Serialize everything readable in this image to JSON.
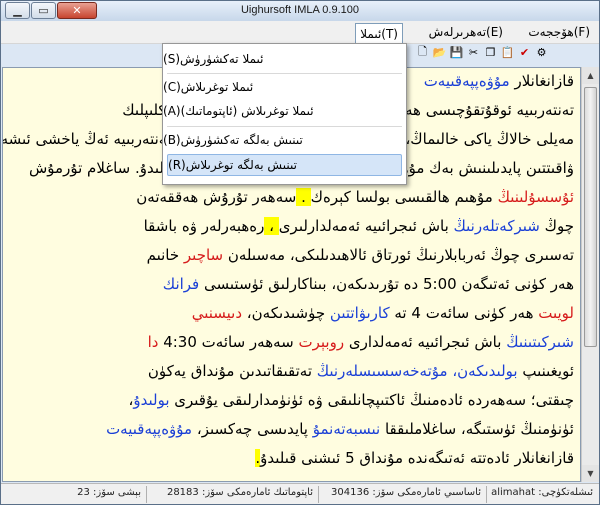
{
  "window": {
    "title": "Uighursoft IMLA 0.9.100"
  },
  "menubar": {
    "items": [
      {
        "label": "ھۆججەت(F)"
      },
      {
        "label": "تەھرىرلەش(E)"
      },
      {
        "label": "ئىملا(T)"
      }
    ]
  },
  "dropdown": {
    "items": [
      {
        "label": "ئىملا تەكشۈرۈش(S)"
      },
      {
        "label": "ئىملا توغرىلاش(C)"
      },
      {
        "label": "ئىملا توغرىلاش (ئاپتوماتىك)(A)"
      },
      {
        "label": "تىنىش بەلگە تەكشۈرۈش(B)"
      },
      {
        "label": "تىنىش بەلگە توغرىلاش(R)"
      }
    ]
  },
  "editor": {
    "lines": [
      [
        {
          "t": "قازانغانلار",
          "c": ""
        },
        {
          "t": " مۇۋەپپەقىيەت",
          "c": "blue"
        }
      ],
      [
        {
          "t": "تەنتەربىيە ئوقۇتقۇچىسى ھەم تەنتەربىيە ھەۋەسكارى، يەرلىك ۋە تەكلىپلىك",
          "c": ""
        }
      ],
      [
        {
          "t": "مەيلى خالاڭ ياكى خالىماڭ",
          "c": ""
        },
        {
          "t": "، ",
          "c": ""
        },
        {
          "t": "ئورۇننى ئىگىلەش ئۈچۈن بەيگە بىلەن تەنتەربىيە ئەڭ ياخشى ئىشەنچلىك",
          "c": ""
        }
      ],
      [
        {
          "t": "ۋاقىتتىن پايدىلىنىش بەك مۇھىم. ئۇستاز بىرلا ۋاقىتتا نۇرغۇن ئىش قىلىدۇ. ساغلام تۇرمۇش",
          "c": ""
        }
      ],
      [
        {
          "t": "ئۇسسۇلىنىڭ",
          "c": "red"
        },
        {
          "t": " مۇھىم ھالقىسى بولسا كېرەك",
          "c": ""
        },
        {
          "t": " . ",
          "c": "hl"
        },
        {
          "t": "سەھەر تۇرۇش ھەققەتەن",
          "c": ""
        }
      ],
      [
        {
          "t": "چوڭ",
          "c": ""
        },
        {
          "t": " شىركەتلەرنىڭ ",
          "c": "blue"
        },
        {
          "t": "باش ئىجرائىيە ئەمەلدارلىرى",
          "c": ""
        },
        {
          "t": " ، ",
          "c": "hl"
        },
        {
          "t": "رەھبەرلەر ۋە باشقا",
          "c": ""
        }
      ],
      [
        {
          "t": "تەسىرى چوڭ ئەربابلارنىڭ ئورتاق ئالاھىدىلىكى، مەسىلەن ",
          "c": ""
        },
        {
          "t": "ساچىر",
          "c": "red"
        },
        {
          "t": " خانىم",
          "c": ""
        }
      ],
      [
        {
          "t": "ھەر كۈنى ئەتىگەن 5:00 دە تۇرىدىكەن، بىناكارلىق ئۈستىسى ",
          "c": ""
        },
        {
          "t": "فرانك",
          "c": "blue"
        }
      ],
      [
        {
          "t": "لويىت",
          "c": "red"
        },
        {
          "t": " ھەر كۈنى سائەت 4 تە ",
          "c": ""
        },
        {
          "t": "كارىۋاتتىن",
          "c": "blue"
        },
        {
          "t": " چۈشىدىكەن، ",
          "c": ""
        },
        {
          "t": "دىيسنىي",
          "c": "red"
        }
      ],
      [
        {
          "t": "شىركىتىنىڭ",
          "c": "blue"
        },
        {
          "t": " باش ئىجرائىيە ئەمەلدارى ",
          "c": ""
        },
        {
          "t": "روبېرت",
          "c": "red"
        },
        {
          "t": " سەھەر سائەت 4:30 ",
          "c": ""
        },
        {
          "t": "دا",
          "c": "red"
        }
      ],
      [
        {
          "t": "ئويغىنىپ ",
          "c": ""
        },
        {
          "t": "بولىدىكەن، ",
          "c": "blue"
        },
        {
          "t": "مۇتەخەسسىسلەرنىڭ",
          "c": "blue"
        },
        {
          "t": " تەتقىقاتىدىن مۇنداق يەكۈن",
          "c": ""
        }
      ],
      [
        {
          "t": "چىقتى؛ سەھەردە ئادەمنىڭ ئاكتىپچانلىقى ۋە ئۈنۈمدارلىقى يۇقىرى ",
          "c": ""
        },
        {
          "t": "بولىدۇ",
          "c": "blue"
        },
        {
          "t": "،",
          "c": ""
        }
      ],
      [
        {
          "t": "ئۈنۈمنىڭ ئۈستىگە، ساغلاملىققا ",
          "c": ""
        },
        {
          "t": "نىسبەتەنمۇ",
          "c": "blue"
        },
        {
          "t": " پايدىسى چەكسىز، ",
          "c": ""
        },
        {
          "t": "مۇۋەپپەقىيەت",
          "c": "blue"
        }
      ],
      [
        {
          "t": "قازانغانلار ئادەتتە ئەتىگەندە مۇنداق 5 ئىشنى قىلىدۇ",
          "c": ""
        },
        {
          "t": ".",
          "c": "hl"
        }
      ]
    ]
  },
  "statusbar": {
    "fields": [
      "ئىشلەتكۈچى: alimahat",
      "ئاساسىي ئامارەمكى سۆز: 304136",
      "ئاپتوماتىك ئامارەمكى سۆز: 28183",
      "بېشى سۆز: 23"
    ]
  },
  "toolbar": {
    "icons": [
      "new-file-icon",
      "open-folder-icon",
      "save-icon",
      "cut-icon",
      "copy-icon",
      "paste-icon",
      "spell-icon",
      "settings-icon"
    ]
  }
}
